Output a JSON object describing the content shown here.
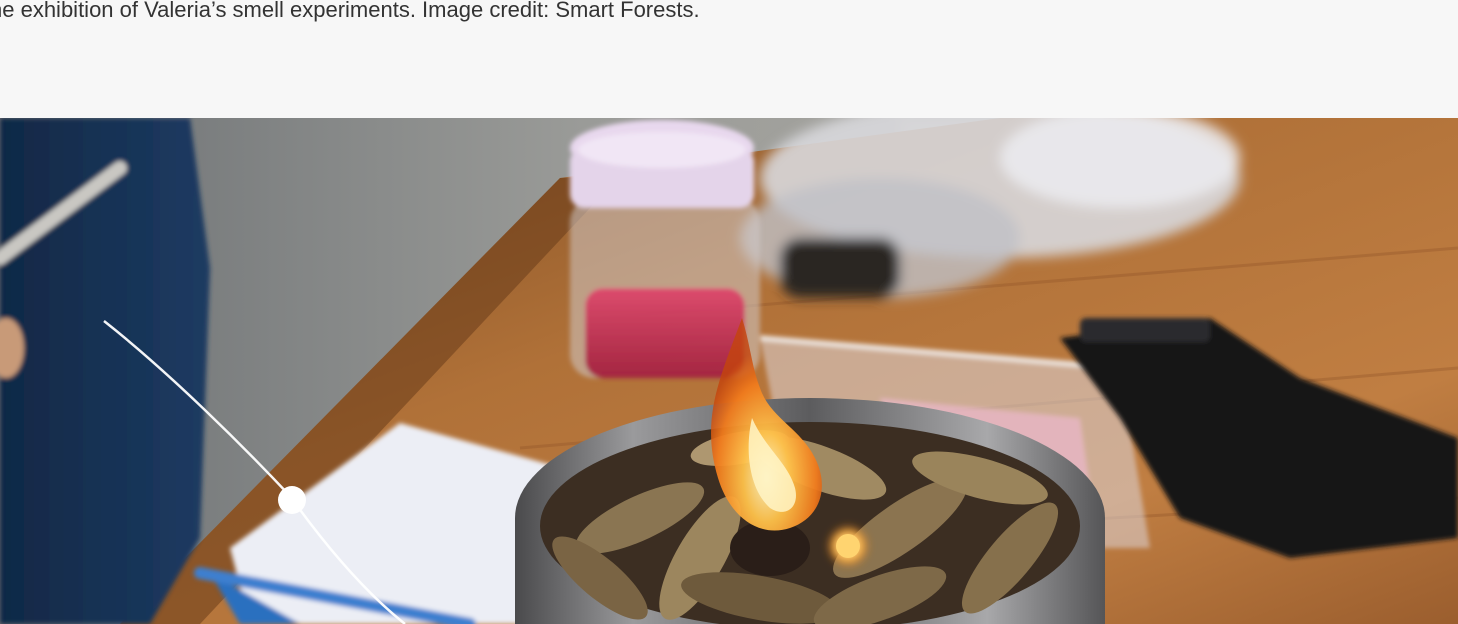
{
  "caption": {
    "text": "he exhibition of Valeria’s smell experiments. Image credit: Smart Forests."
  },
  "photo": {
    "subject_icon": "burning-leaves-photo-icon",
    "colors": {
      "background": "#f7f7f7",
      "caption_text": "#333333",
      "table_wood": "#a86a36",
      "flame": "#ffb030",
      "timeline_line": "#ffffff"
    }
  }
}
